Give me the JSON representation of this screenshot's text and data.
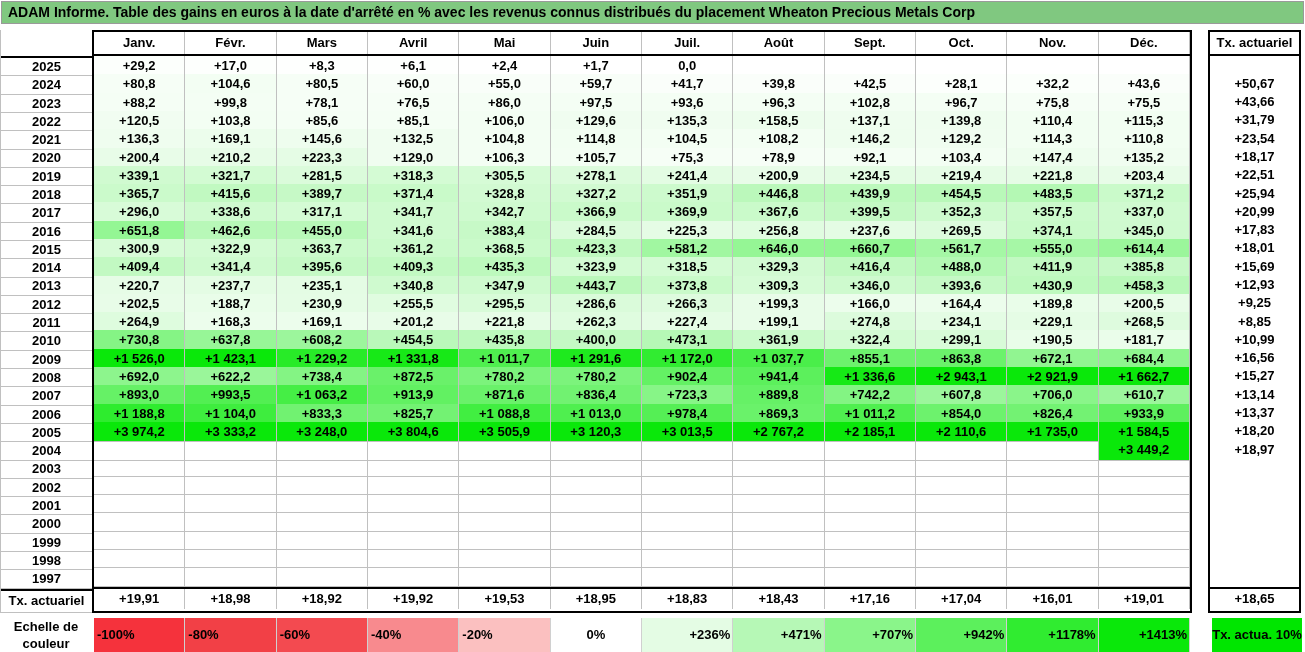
{
  "title": "ADAM Informe. Table des gains en euros à la date d'arrêté en % avec les revenus connus distribués du placement Wheaton Precious Metals Corp",
  "columns": [
    "Janv.",
    "Févr.",
    "Mars",
    "Avril",
    "Mai",
    "Juin",
    "Juil.",
    "Août",
    "Sept.",
    "Oct.",
    "Nov.",
    "Déc."
  ],
  "rate_header": "Tx. actuariel",
  "rows": [
    {
      "year": "2025",
      "values": [
        "+29,2",
        "+17,0",
        "+8,3",
        "+6,1",
        "+2,4",
        "+1,7",
        "0,0"
      ]
    },
    {
      "year": "2024",
      "values": [
        "+80,8",
        "+104,6",
        "+80,5",
        "+60,0",
        "+55,0",
        "+59,7",
        "+41,7",
        "+39,8",
        "+42,5",
        "+28,1",
        "+32,2",
        "+43,6"
      ],
      "rate": "+50,67"
    },
    {
      "year": "2023",
      "values": [
        "+88,2",
        "+99,8",
        "+78,1",
        "+76,5",
        "+86,0",
        "+97,5",
        "+93,6",
        "+96,3",
        "+102,8",
        "+96,7",
        "+75,8",
        "+75,5"
      ],
      "rate": "+43,66"
    },
    {
      "year": "2022",
      "values": [
        "+120,5",
        "+103,8",
        "+85,6",
        "+85,1",
        "+106,0",
        "+129,6",
        "+135,3",
        "+158,5",
        "+137,1",
        "+139,8",
        "+110,4",
        "+115,3"
      ],
      "rate": "+31,79"
    },
    {
      "year": "2021",
      "values": [
        "+136,3",
        "+169,1",
        "+145,6",
        "+132,5",
        "+104,8",
        "+114,8",
        "+104,5",
        "+108,2",
        "+146,2",
        "+129,2",
        "+114,3",
        "+110,8"
      ],
      "rate": "+23,54"
    },
    {
      "year": "2020",
      "values": [
        "+200,4",
        "+210,2",
        "+223,3",
        "+129,0",
        "+106,3",
        "+105,7",
        "+75,3",
        "+78,9",
        "+92,1",
        "+103,4",
        "+147,4",
        "+135,2"
      ],
      "rate": "+18,17"
    },
    {
      "year": "2019",
      "values": [
        "+339,1",
        "+321,7",
        "+281,5",
        "+318,3",
        "+305,5",
        "+278,1",
        "+241,4",
        "+200,9",
        "+234,5",
        "+219,4",
        "+221,8",
        "+203,4"
      ],
      "rate": "+22,51"
    },
    {
      "year": "2018",
      "values": [
        "+365,7",
        "+415,6",
        "+389,7",
        "+371,4",
        "+328,8",
        "+327,2",
        "+351,9",
        "+446,8",
        "+439,9",
        "+454,5",
        "+483,5",
        "+371,2"
      ],
      "rate": "+25,94"
    },
    {
      "year": "2017",
      "values": [
        "+296,0",
        "+338,6",
        "+317,1",
        "+341,7",
        "+342,7",
        "+366,9",
        "+369,9",
        "+367,6",
        "+399,5",
        "+352,3",
        "+357,5",
        "+337,0"
      ],
      "rate": "+20,99"
    },
    {
      "year": "2016",
      "values": [
        "+651,8",
        "+462,6",
        "+455,0",
        "+341,6",
        "+383,4",
        "+284,5",
        "+225,3",
        "+256,8",
        "+237,6",
        "+269,5",
        "+374,1",
        "+345,0"
      ],
      "rate": "+17,83"
    },
    {
      "year": "2015",
      "values": [
        "+300,9",
        "+322,9",
        "+363,7",
        "+361,2",
        "+368,5",
        "+423,3",
        "+581,2",
        "+646,0",
        "+660,7",
        "+561,7",
        "+555,0",
        "+614,4"
      ],
      "rate": "+18,01"
    },
    {
      "year": "2014",
      "values": [
        "+409,4",
        "+341,4",
        "+395,6",
        "+409,3",
        "+435,3",
        "+323,9",
        "+318,5",
        "+329,3",
        "+416,4",
        "+488,0",
        "+411,9",
        "+385,8"
      ],
      "rate": "+15,69"
    },
    {
      "year": "2013",
      "values": [
        "+220,7",
        "+237,7",
        "+235,1",
        "+340,8",
        "+347,9",
        "+443,7",
        "+373,8",
        "+309,3",
        "+346,0",
        "+393,6",
        "+430,9",
        "+458,3"
      ],
      "rate": "+12,93"
    },
    {
      "year": "2012",
      "values": [
        "+202,5",
        "+188,7",
        "+230,9",
        "+255,5",
        "+295,5",
        "+286,6",
        "+266,3",
        "+199,3",
        "+166,0",
        "+164,4",
        "+189,8",
        "+200,5"
      ],
      "rate": "+9,25"
    },
    {
      "year": "2011",
      "values": [
        "+264,9",
        "+168,3",
        "+169,1",
        "+201,2",
        "+221,8",
        "+262,3",
        "+227,4",
        "+199,1",
        "+274,8",
        "+234,1",
        "+229,1",
        "+268,5"
      ],
      "rate": "+8,85"
    },
    {
      "year": "2010",
      "values": [
        "+730,8",
        "+637,8",
        "+608,2",
        "+454,5",
        "+435,8",
        "+400,0",
        "+473,1",
        "+361,9",
        "+322,4",
        "+299,1",
        "+190,5",
        "+181,7"
      ],
      "rate": "+10,99"
    },
    {
      "year": "2009",
      "values": [
        "+1 526,0",
        "+1 423,1",
        "+1 229,2",
        "+1 331,8",
        "+1 011,7",
        "+1 291,6",
        "+1 172,0",
        "+1 037,7",
        "+855,1",
        "+863,8",
        "+672,1",
        "+684,4"
      ],
      "rate": "+16,56"
    },
    {
      "year": "2008",
      "values": [
        "+692,0",
        "+622,2",
        "+738,4",
        "+872,5",
        "+780,2",
        "+780,2",
        "+902,4",
        "+941,4",
        "+1 336,6",
        "+2 943,1",
        "+2 921,9",
        "+1 662,7"
      ],
      "rate": "+15,27"
    },
    {
      "year": "2007",
      "values": [
        "+893,0",
        "+993,5",
        "+1 063,2",
        "+913,9",
        "+871,6",
        "+836,4",
        "+723,3",
        "+889,8",
        "+742,2",
        "+607,8",
        "+706,0",
        "+610,7"
      ],
      "rate": "+13,14"
    },
    {
      "year": "2006",
      "values": [
        "+1 188,8",
        "+1 104,0",
        "+833,3",
        "+825,7",
        "+1 088,8",
        "+1 013,0",
        "+978,4",
        "+869,3",
        "+1 011,2",
        "+854,0",
        "+826,4",
        "+933,9"
      ],
      "rate": "+13,37"
    },
    {
      "year": "2005",
      "values": [
        "+3 974,2",
        "+3 333,2",
        "+3 248,0",
        "+3 804,6",
        "+3 505,9",
        "+3 120,3",
        "+3 013,5",
        "+2 767,2",
        "+2 185,1",
        "+2 110,6",
        "+1 735,0",
        "+1 584,5"
      ],
      "rate": "+18,20"
    },
    {
      "year": "2004",
      "values_from_december": [
        "+3 449,2"
      ],
      "rate": "+18,97"
    },
    {
      "year": "2003"
    },
    {
      "year": "2002"
    },
    {
      "year": "2001"
    },
    {
      "year": "2000"
    },
    {
      "year": "1999"
    },
    {
      "year": "1998"
    },
    {
      "year": "1997"
    }
  ],
  "footer": {
    "label": "Tx. actuariel",
    "values": [
      "+19,91",
      "+18,98",
      "+18,92",
      "+19,92",
      "+19,53",
      "+18,95",
      "+18,83",
      "+18,43",
      "+17,16",
      "+17,04",
      "+16,01",
      "+19,01"
    ],
    "rate": "+18,65"
  },
  "scale": {
    "label": "Echelle de couleur",
    "stops": [
      {
        "label": "-100%",
        "color": "#f5323c"
      },
      {
        "label": "-80%",
        "color": "#f24046"
      },
      {
        "label": "-60%",
        "color": "#f34a50"
      },
      {
        "label": "-40%",
        "color": "#f88a8e"
      },
      {
        "label": "-20%",
        "color": "#fbc0c0"
      },
      {
        "label": "0%",
        "color": "#ffffff"
      },
      {
        "label": "+236%",
        "color": "#e4fce4"
      },
      {
        "label": "+471%",
        "color": "#b6f8b6"
      },
      {
        "label": "+707%",
        "color": "#8af58a"
      },
      {
        "label": "+942%",
        "color": "#5cf05c"
      },
      {
        "label": "+1178%",
        "color": "#30ec30"
      },
      {
        "label": "+1413%",
        "color": "#0ae80a"
      }
    ],
    "rate_note": {
      "label": "Tx. actua. 10%",
      "color": "#00e600"
    }
  }
}
